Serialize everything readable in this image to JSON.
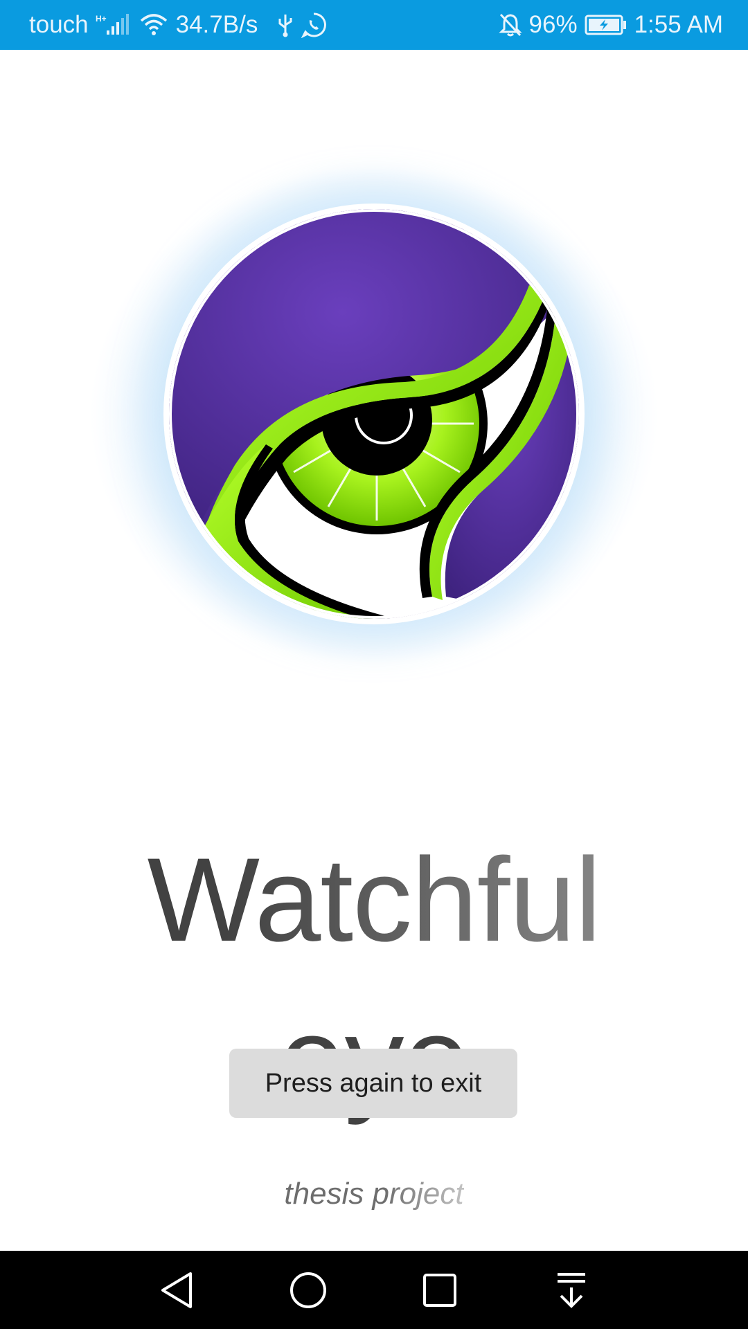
{
  "status_bar": {
    "carrier": "touch",
    "network_type": "H+",
    "data_speed": "34.7B/s",
    "battery_percent": "96%",
    "time": "1:55 AM",
    "icons": [
      "signal-icon",
      "wifi-icon",
      "usb-icon",
      "whatsapp-icon",
      "mute-bell-icon",
      "battery-charging-icon"
    ],
    "background_color": "#0a9be0"
  },
  "app": {
    "title_line1": "Watchful",
    "title_line2": "eye",
    "subtitle": "thesis project",
    "logo_icon": "watchful-eye-logo",
    "logo_colors": {
      "purple": "#5a35a8",
      "green": "#8ee000",
      "black": "#000000"
    }
  },
  "toast": {
    "message": "Press again to exit"
  },
  "nav_bar": {
    "buttons": [
      "back-icon",
      "home-icon",
      "recents-icon",
      "notification-pull-icon"
    ]
  }
}
